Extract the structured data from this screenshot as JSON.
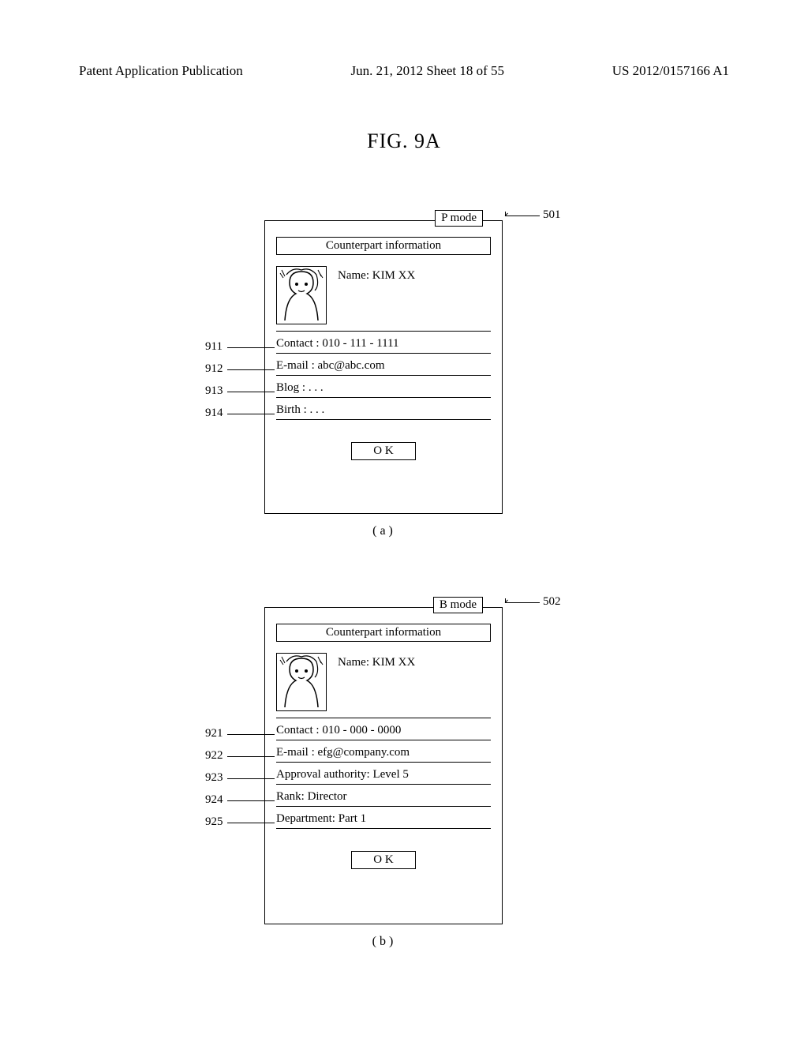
{
  "header": {
    "left": "Patent Application Publication",
    "center": "Jun. 21, 2012  Sheet 18 of 55",
    "right": "US 2012/0157166 A1"
  },
  "figure_title": "FIG. 9A",
  "panel_a": {
    "mode_label": "P mode",
    "mode_ref": "501",
    "section_title": "Counterpart information",
    "name": "Name: KIM XX",
    "fields": [
      "Contact : 010 - 111 - 1111",
      "E-mail : abc@abc.com",
      "Blog :    . . .",
      "Birth :    . . ."
    ],
    "field_refs": [
      "911",
      "912",
      "913",
      "914"
    ],
    "ok": "O K",
    "sub": "( a )"
  },
  "panel_b": {
    "mode_label": "B mode",
    "mode_ref": "502",
    "section_title": "Counterpart information",
    "name": "Name: KIM XX",
    "fields": [
      "Contact : 010 - 000 - 0000",
      "E-mail : efg@company.com",
      "Approval authority: Level 5",
      "Rank: Director",
      "Department: Part 1"
    ],
    "field_refs": [
      "921",
      "922",
      "923",
      "924",
      "925"
    ],
    "ok": "O K",
    "sub": "( b )"
  }
}
